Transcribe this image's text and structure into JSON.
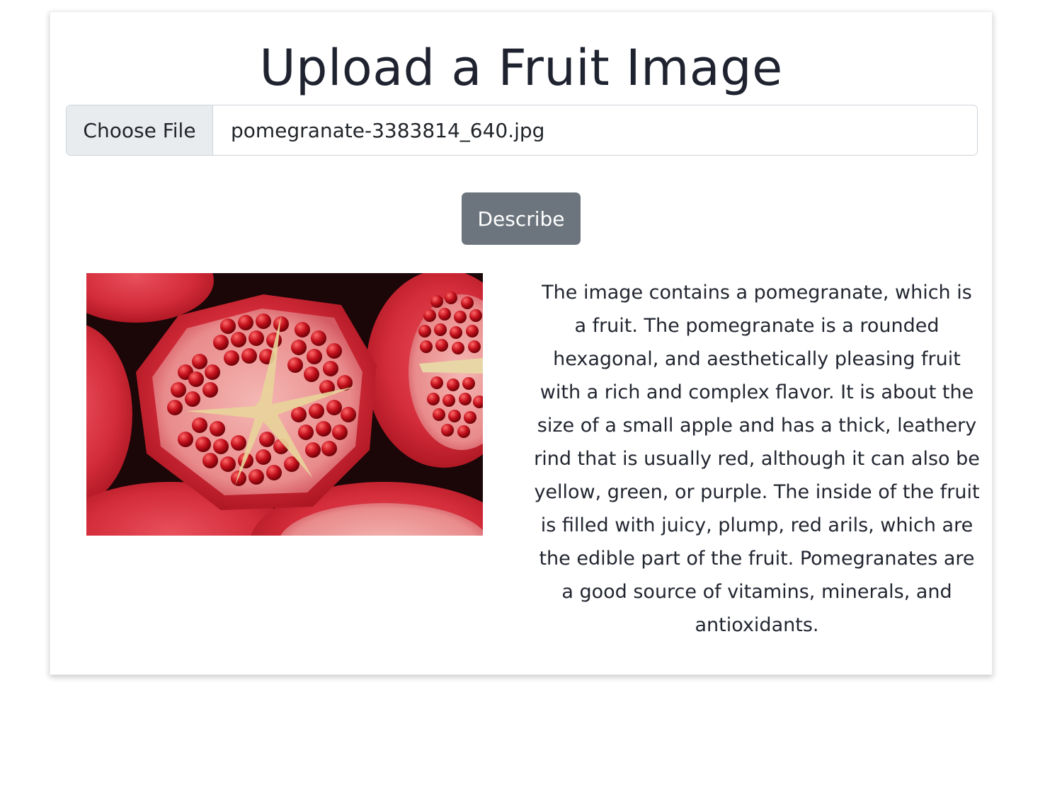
{
  "page": {
    "title": "Upload a Fruit Image"
  },
  "file_input": {
    "button_label": "Choose File",
    "file_name": "pomegranate-3383814_640.jpg"
  },
  "actions": {
    "describe_label": "Describe"
  },
  "result": {
    "image_icon": "pomegranate-photo",
    "description": "The image contains a pomegranate, which is a fruit. The pomegranate is a rounded hexagonal, and aesthetically pleasing fruit with a rich and complex flavor. It is about the size of a small apple and has a thick, leathery rind that is usually red, although it can also be yellow, green, or purple. The inside of the fruit is filled with juicy, plump, red arils, which are the edible part of the fruit. Pomegranates are a good source of vitamins, minerals, and antioxidants."
  },
  "colors": {
    "button_secondary": "#6c757d",
    "file_button_bg": "#e9ecef",
    "border": "#ced4da",
    "fruit_red": "#c8202c"
  }
}
